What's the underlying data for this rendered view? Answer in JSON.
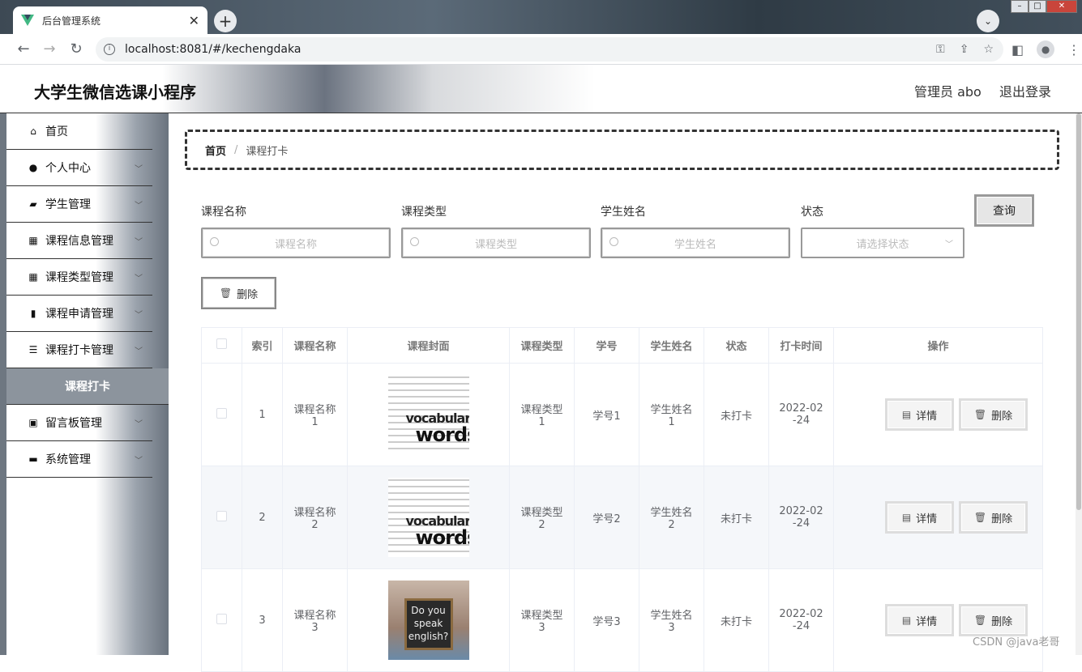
{
  "browser": {
    "tab_title": "后台管理系统",
    "tab_close": "✕",
    "new_tab": "+",
    "url": "localhost:8081/#/kechengdaka"
  },
  "header": {
    "app_title": "大学生微信选课小程序",
    "user": "管理员 abo",
    "logout": "退出登录"
  },
  "sidebar": {
    "items": [
      {
        "label": "首页",
        "icon": "home-icon",
        "glyph": "⌂",
        "chevron": false
      },
      {
        "label": "个人中心",
        "icon": "user-icon",
        "glyph": "●",
        "chevron": true
      },
      {
        "label": "学生管理",
        "icon": "wallet-icon",
        "glyph": "▰",
        "chevron": true
      },
      {
        "label": "课程信息管理",
        "icon": "grid-icon",
        "glyph": "▦",
        "chevron": true
      },
      {
        "label": "课程类型管理",
        "icon": "grid-icon",
        "glyph": "▦",
        "chevron": true
      },
      {
        "label": "课程申请管理",
        "icon": "bar-chart-icon",
        "glyph": "▮",
        "chevron": true
      },
      {
        "label": "课程打卡管理",
        "icon": "list-icon",
        "glyph": "☰",
        "chevron": true
      }
    ],
    "submenu_active": "课程打卡",
    "items_after": [
      {
        "label": "留言板管理",
        "icon": "clipboard-icon",
        "glyph": "▣",
        "chevron": true
      },
      {
        "label": "系统管理",
        "icon": "monitor-icon",
        "glyph": "▬",
        "chevron": true
      }
    ]
  },
  "breadcrumb": {
    "home": "首页",
    "separator": "/",
    "current": "课程打卡"
  },
  "search": {
    "course_name_label": "课程名称",
    "course_name_placeholder": "课程名称",
    "course_type_label": "课程类型",
    "course_type_placeholder": "课程类型",
    "student_name_label": "学生姓名",
    "student_name_placeholder": "学生姓名",
    "status_label": "状态",
    "status_placeholder": "请选择状态",
    "query_button": "查询"
  },
  "toolbar": {
    "delete_button": "删除"
  },
  "table": {
    "columns": [
      "索引",
      "课程名称",
      "课程封面",
      "课程类型",
      "学号",
      "学生姓名",
      "状态",
      "打卡时间",
      "操作"
    ],
    "rows": [
      {
        "index": "1",
        "name_a": "课程名称",
        "name_b": "1",
        "cover": "vocabulary-words",
        "type_a": "课程类型",
        "type_b": "1",
        "student_id": "学号1",
        "student_a": "学生姓名",
        "student_b": "1",
        "status": "未打卡",
        "time_a": "2022-02",
        "time_b": "-24",
        "detail": "详情",
        "delete": "删除"
      },
      {
        "index": "2",
        "name_a": "课程名称",
        "name_b": "2",
        "cover": "vocabulary-words",
        "type_a": "课程类型",
        "type_b": "2",
        "student_id": "学号2",
        "student_a": "学生姓名",
        "student_b": "2",
        "status": "未打卡",
        "time_a": "2022-02",
        "time_b": "-24",
        "detail": "详情",
        "delete": "删除"
      },
      {
        "index": "3",
        "name_a": "课程名称",
        "name_b": "3",
        "cover": "do-you-speak-english",
        "type_a": "课程类型",
        "type_b": "3",
        "student_id": "学号3",
        "student_a": "学生姓名",
        "student_b": "3",
        "status": "未打卡",
        "time_a": "2022-02",
        "time_b": "-24",
        "detail": "详情",
        "delete": "删除"
      }
    ],
    "cover_text": {
      "w1": "vocabulary",
      "w2": "words",
      "speak": "Do you speak english?"
    }
  },
  "watermark": "CSDN @java老哥"
}
